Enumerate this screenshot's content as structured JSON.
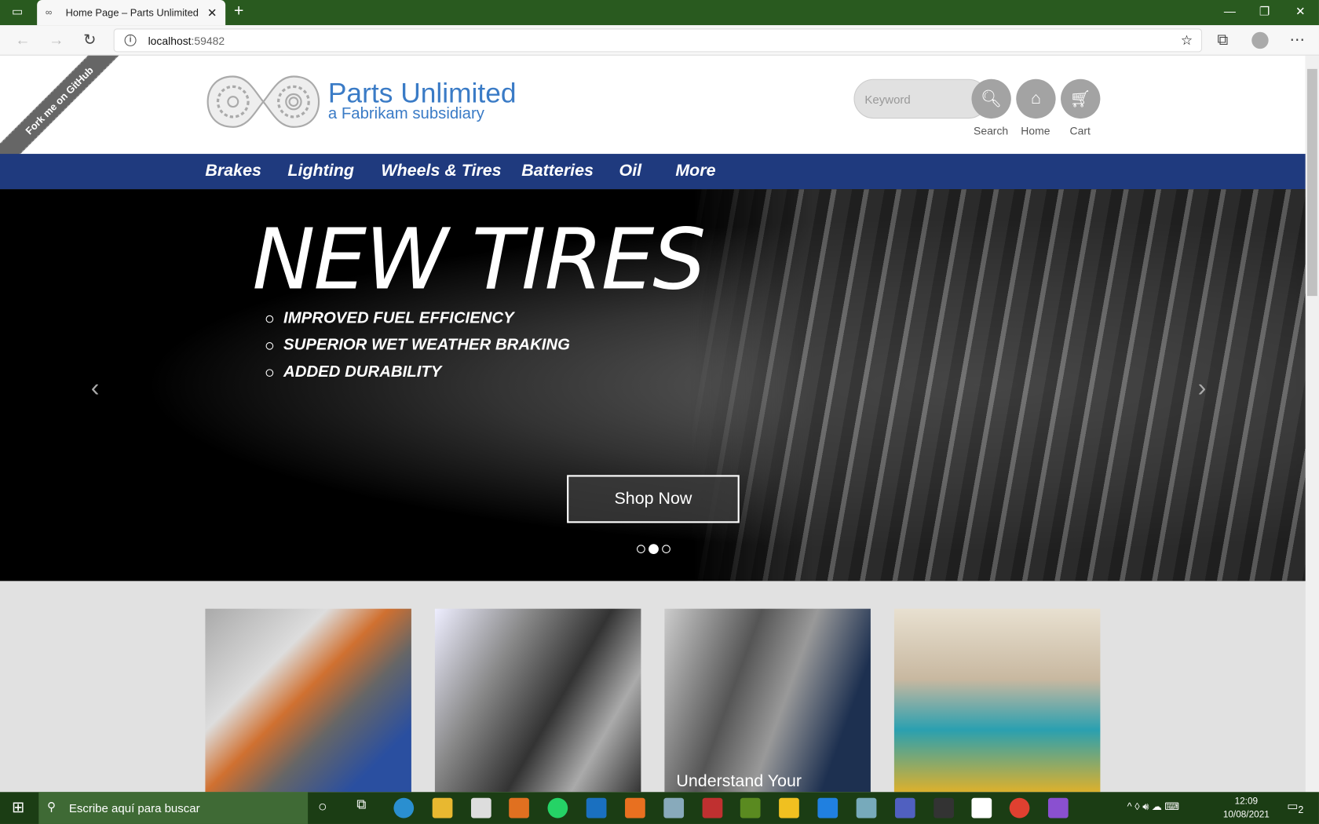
{
  "browser": {
    "tab_title": "Home Page – Parts Unlimited",
    "url_host": "localhost",
    "url_port": ":59482"
  },
  "header": {
    "ribbon": "Fork me on GitHub",
    "brand": "Parts Unlimited",
    "subtitle": "a Fabrikam subsidiary",
    "search_placeholder": "Keyword",
    "search_label": "Search",
    "home_label": "Home",
    "cart_label": "Cart"
  },
  "nav": [
    "Brakes",
    "Lighting",
    "Wheels & Tires",
    "Batteries",
    "Oil",
    "More"
  ],
  "hero": {
    "title": "NEW TIRES",
    "bullets": [
      "IMPROVED FUEL EFFICIENCY",
      "SUPERIOR WET WEATHER BRAKING",
      "ADDED DURABILITY"
    ],
    "button": "Shop Now",
    "active_slide": 2,
    "slide_count": 3
  },
  "cards": [
    {
      "caption": ""
    },
    {
      "caption": ""
    },
    {
      "caption": "Understand Your"
    },
    {
      "caption": ""
    }
  ],
  "taskbar": {
    "search_placeholder": "Escribe aquí para buscar",
    "time": "12:09",
    "date": "10/08/2021",
    "notifications": "2"
  }
}
